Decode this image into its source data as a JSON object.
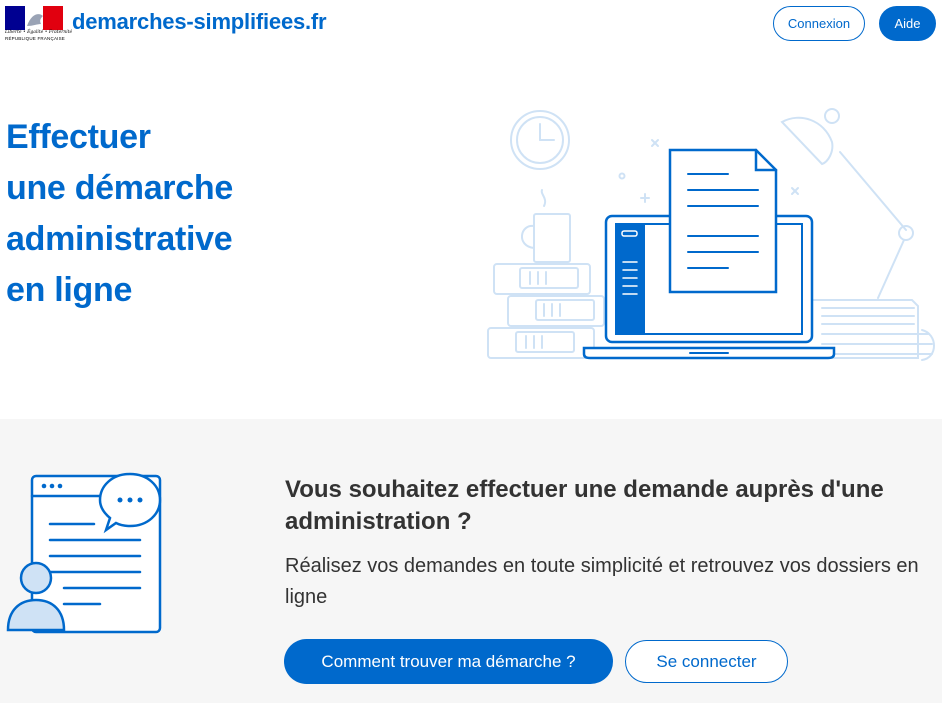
{
  "header": {
    "logo_motto": "Liberté • Égalité • Fraternité",
    "logo_country": "RÉPUBLIQUE FRANÇAISE",
    "brand": "demarches-simplifiees.fr",
    "login_label": "Connexion",
    "help_label": "Aide"
  },
  "hero": {
    "title_lines": [
      "Effectuer",
      "une démarche",
      "administrative",
      "en ligne"
    ]
  },
  "band": {
    "title": "Vous souhaitez effectuer une demande auprès d'une administration ?",
    "text": "Réalisez vos demandes en toute simplicité et retrouvez vos dossiers en ligne",
    "primary_button": "Comment trouver ma démarche ?",
    "secondary_button": "Se connecter"
  },
  "colors": {
    "accent": "#0069cc",
    "illustration_light": "#cfe2f5",
    "band_background": "#f6f6f6",
    "text_dark": "#333333"
  }
}
